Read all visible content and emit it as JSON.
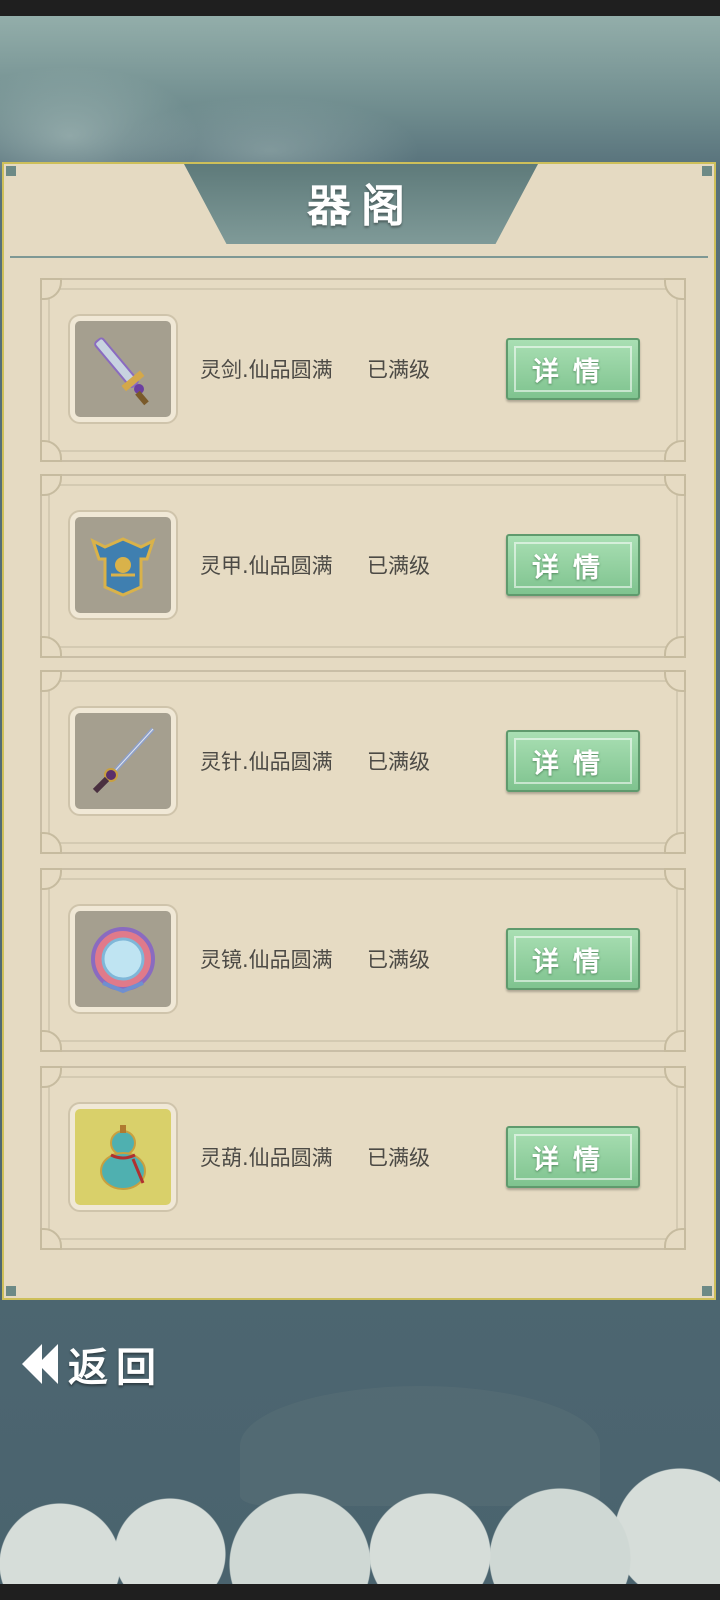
{
  "panel": {
    "title": "器阁"
  },
  "items": [
    {
      "name": "灵剑.仙品圆满",
      "level": "已满级",
      "button": "详情",
      "icon": "sword-icon"
    },
    {
      "name": "灵甲.仙品圆满",
      "level": "已满级",
      "button": "详情",
      "icon": "armor-icon"
    },
    {
      "name": "灵针.仙品圆满",
      "level": "已满级",
      "button": "详情",
      "icon": "needle-icon"
    },
    {
      "name": "灵镜.仙品圆满",
      "level": "已满级",
      "button": "详情",
      "icon": "mirror-icon"
    },
    {
      "name": "灵葫.仙品圆满",
      "level": "已满级",
      "button": "详情",
      "icon": "gourd-icon"
    }
  ],
  "footer": {
    "back_label": "返回"
  },
  "colors": {
    "panel_bg": "#e5dac2",
    "button_green": "#8fcf9c",
    "header_teal": "#6f8c8e"
  }
}
